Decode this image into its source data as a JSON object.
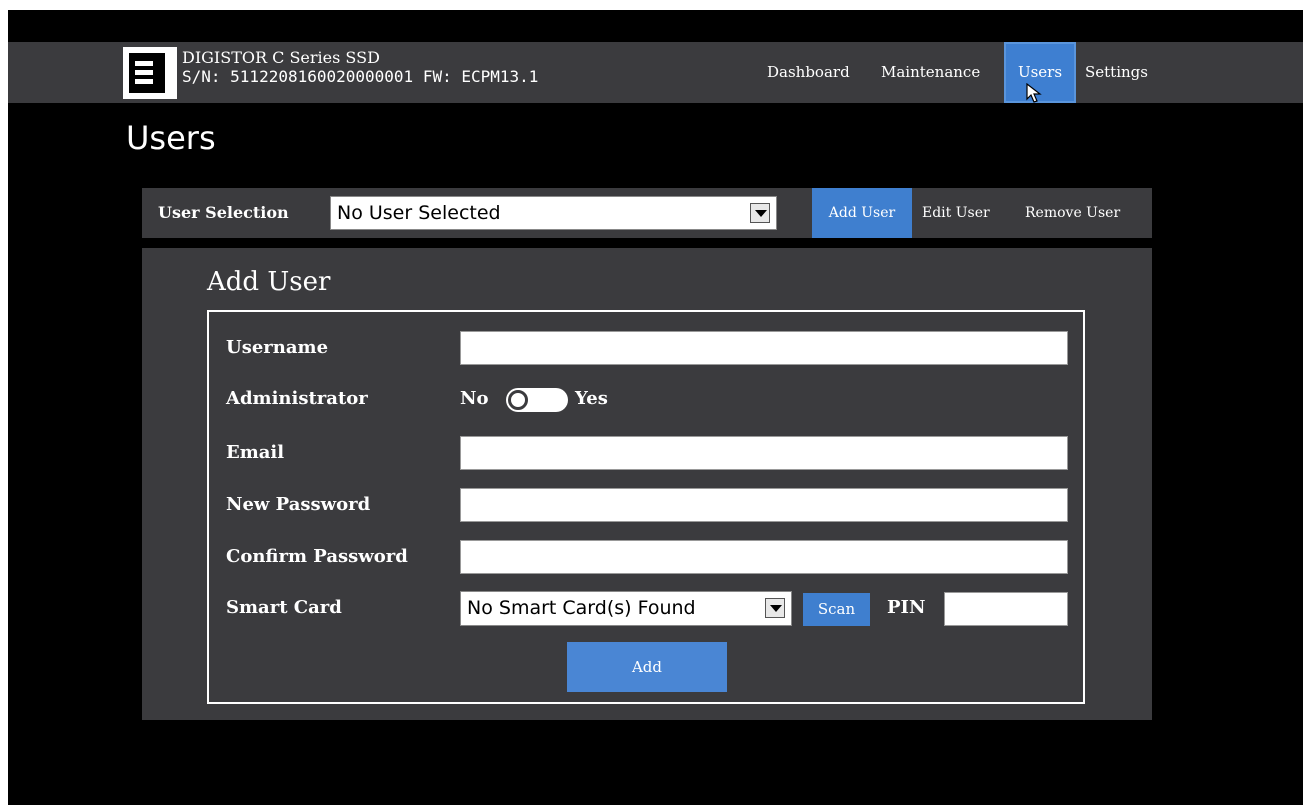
{
  "header": {
    "logo_icon": "digistor-logo-icon",
    "device_name": "DIGISTOR C Series SSD",
    "device_info": "S/N: 5112208160020000001 FW: ECPM13.1",
    "nav": [
      {
        "label": "Dashboard",
        "active": false
      },
      {
        "label": "Maintenance",
        "active": false
      },
      {
        "label": "Users",
        "active": true
      },
      {
        "label": "Settings",
        "active": false
      }
    ]
  },
  "page": {
    "title": "Users"
  },
  "selection_bar": {
    "label": "User Selection",
    "selected_user": "No User Selected",
    "tabs": [
      {
        "label": "Add User",
        "active": true
      },
      {
        "label": "Edit User",
        "active": false
      },
      {
        "label": "Remove User",
        "active": false
      }
    ]
  },
  "form": {
    "title": "Add User",
    "username_label": "Username",
    "administrator_label": "Administrator",
    "administrator_no": "No",
    "administrator_yes": "Yes",
    "administrator_value": false,
    "email_label": "Email",
    "new_password_label": "New Password",
    "confirm_password_label": "Confirm Password",
    "smart_card_label": "Smart Card",
    "smart_card_selected": "No Smart Card(s) Found",
    "scan_label": "Scan",
    "pin_label": "PIN",
    "add_label": "Add"
  },
  "colors": {
    "accent": "#3f7fcf",
    "panel": "#3b3b3e",
    "background": "#000000"
  }
}
